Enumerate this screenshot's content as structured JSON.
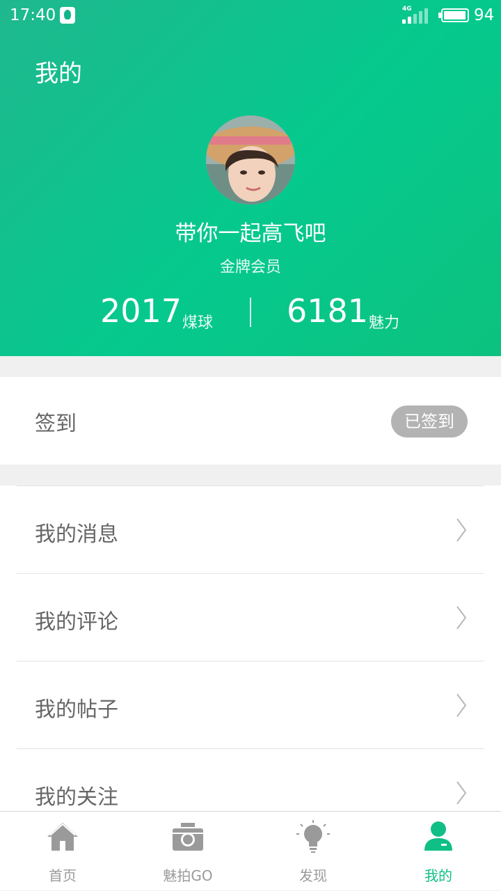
{
  "status_bar": {
    "time": "17:40",
    "network": "4G",
    "battery": "94"
  },
  "header": {
    "title": "我的",
    "username": "带你一起高飞吧",
    "member_level": "金牌会员",
    "stats": [
      {
        "value": "2017",
        "label": "煤球"
      },
      {
        "value": "6181",
        "label": "魅力"
      }
    ]
  },
  "checkin": {
    "label": "签到",
    "status": "已签到"
  },
  "menu": {
    "items": [
      {
        "label": "我的消息"
      },
      {
        "label": "我的评论"
      },
      {
        "label": "我的帖子"
      },
      {
        "label": "我的关注"
      }
    ]
  },
  "bottom_nav": {
    "items": [
      {
        "label": "首页",
        "icon": "home-icon"
      },
      {
        "label": "魅拍GO",
        "icon": "camera-icon"
      },
      {
        "label": "发现",
        "icon": "lightbulb-icon"
      },
      {
        "label": "我的",
        "icon": "person-icon",
        "active": true
      }
    ]
  },
  "colors": {
    "accent": "#0fbf86",
    "badge": "#b3b3b3"
  }
}
